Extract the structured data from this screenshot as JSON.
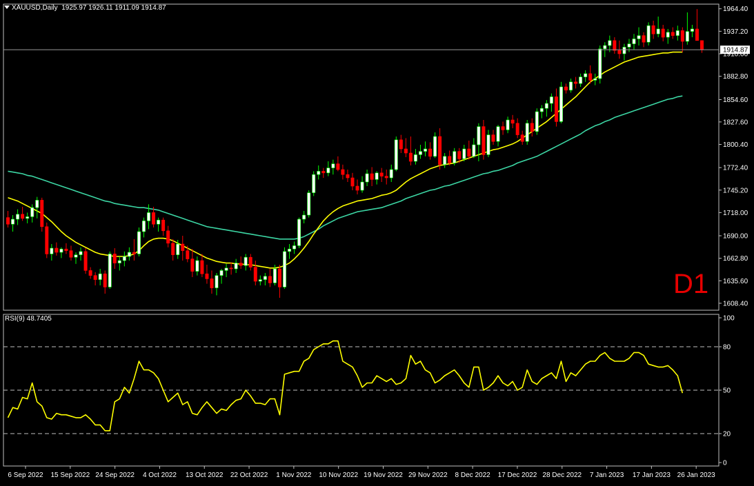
{
  "header": {
    "symbol": "XAUUSD,Daily",
    "ohlc": "1925.97 1926.11 1911.09 1914.87"
  },
  "timeframe_label": "D1",
  "colors": {
    "background": "#000000",
    "grid": "#c0c0c0",
    "bull": "#ffffff",
    "bear": "#ff0000",
    "ma_fast": "#ffff00",
    "ma_slow": "#3cd6a4",
    "rsi": "#ffff00",
    "timeframe": "#e60000"
  },
  "chart_data": [
    {
      "type": "candlestick",
      "title": "XAUUSD,Daily",
      "ylim": [
        1600,
        1970
      ],
      "y_ticks": [
        "1964.40",
        "1937.20",
        "1910.00",
        "1882.80",
        "1854.60",
        "1827.60",
        "1800.40",
        "1772.40",
        "1745.20",
        "1718.00",
        "1690.00",
        "1662.80",
        "1635.60",
        "1608.40"
      ],
      "last_price": "1914.87",
      "x_ticks": [
        "6 Sep 2022",
        "15 Sep 2022",
        "24 Sep 2022",
        "4 Oct 2022",
        "13 Oct 2022",
        "22 Oct 2022",
        "1 Nov 2022",
        "10 Nov 2022",
        "19 Nov 2022",
        "29 Nov 2022",
        "8 Dec 2022",
        "17 Dec 2022",
        "28 Dec 2022",
        "7 Jan 2023",
        "17 Jan 2023",
        "26 Jan 2023"
      ],
      "candles": [
        [
          1712,
          1720,
          1700,
          1704
        ],
        [
          1704,
          1715,
          1695,
          1710
        ],
        [
          1710,
          1722,
          1703,
          1716
        ],
        [
          1716,
          1725,
          1708,
          1711
        ],
        [
          1711,
          1718,
          1705,
          1713
        ],
        [
          1713,
          1728,
          1706,
          1724
        ],
        [
          1724,
          1737,
          1711,
          1733
        ],
        [
          1733,
          1736,
          1695,
          1701
        ],
        [
          1701,
          1706,
          1663,
          1668
        ],
        [
          1668,
          1680,
          1660,
          1675
        ],
        [
          1675,
          1682,
          1666,
          1670
        ],
        [
          1670,
          1676,
          1663,
          1674
        ],
        [
          1674,
          1681,
          1668,
          1672
        ],
        [
          1672,
          1678,
          1660,
          1664
        ],
        [
          1664,
          1670,
          1656,
          1667
        ],
        [
          1667,
          1676,
          1660,
          1671
        ],
        [
          1671,
          1675,
          1644,
          1648
        ],
        [
          1648,
          1652,
          1638,
          1642
        ],
        [
          1642,
          1646,
          1630,
          1637
        ],
        [
          1637,
          1650,
          1630,
          1644
        ],
        [
          1644,
          1648,
          1620,
          1628
        ],
        [
          1628,
          1671,
          1626,
          1668
        ],
        [
          1668,
          1675,
          1650,
          1657
        ],
        [
          1657,
          1665,
          1648,
          1660
        ],
        [
          1660,
          1671,
          1653,
          1665
        ],
        [
          1665,
          1676,
          1660,
          1670
        ],
        [
          1670,
          1686,
          1660,
          1668
        ],
        [
          1668,
          1700,
          1665,
          1695
        ],
        [
          1695,
          1712,
          1688,
          1708
        ],
        [
          1708,
          1728,
          1698,
          1718
        ],
        [
          1718,
          1725,
          1700,
          1704
        ],
        [
          1704,
          1712,
          1695,
          1709
        ],
        [
          1709,
          1712,
          1690,
          1696
        ],
        [
          1696,
          1702,
          1676,
          1681
        ],
        [
          1681,
          1686,
          1660,
          1667
        ],
        [
          1667,
          1685,
          1662,
          1680
        ],
        [
          1680,
          1690,
          1660,
          1672
        ],
        [
          1672,
          1678,
          1658,
          1662
        ],
        [
          1662,
          1674,
          1640,
          1647
        ],
        [
          1647,
          1665,
          1642,
          1660
        ],
        [
          1660,
          1668,
          1640,
          1644
        ],
        [
          1644,
          1655,
          1632,
          1638
        ],
        [
          1638,
          1648,
          1620,
          1627
        ],
        [
          1627,
          1645,
          1618,
          1642
        ],
        [
          1642,
          1650,
          1632,
          1648
        ],
        [
          1648,
          1656,
          1640,
          1651
        ],
        [
          1651,
          1658,
          1643,
          1650
        ],
        [
          1650,
          1662,
          1645,
          1657
        ],
        [
          1657,
          1665,
          1650,
          1654
        ],
        [
          1654,
          1668,
          1648,
          1664
        ],
        [
          1664,
          1668,
          1648,
          1652
        ],
        [
          1652,
          1660,
          1630,
          1635
        ],
        [
          1635,
          1642,
          1630,
          1637
        ],
        [
          1637,
          1645,
          1630,
          1641
        ],
        [
          1641,
          1650,
          1628,
          1633
        ],
        [
          1633,
          1655,
          1630,
          1650
        ],
        [
          1650,
          1655,
          1615,
          1628
        ],
        [
          1628,
          1676,
          1626,
          1671
        ],
        [
          1671,
          1680,
          1662,
          1674
        ],
        [
          1674,
          1683,
          1668,
          1678
        ],
        [
          1678,
          1712,
          1675,
          1710
        ],
        [
          1710,
          1720,
          1705,
          1715
        ],
        [
          1715,
          1745,
          1712,
          1742
        ],
        [
          1742,
          1768,
          1738,
          1764
        ],
        [
          1764,
          1775,
          1758,
          1768
        ],
        [
          1768,
          1772,
          1760,
          1766
        ],
        [
          1766,
          1780,
          1762,
          1772
        ],
        [
          1772,
          1782,
          1764,
          1777
        ],
        [
          1777,
          1786,
          1768,
          1770
        ],
        [
          1770,
          1776,
          1758,
          1764
        ],
        [
          1764,
          1770,
          1755,
          1760
        ],
        [
          1760,
          1766,
          1745,
          1750
        ],
        [
          1750,
          1758,
          1740,
          1745
        ],
        [
          1745,
          1762,
          1742,
          1755
        ],
        [
          1755,
          1770,
          1750,
          1765
        ],
        [
          1765,
          1773,
          1750,
          1758
        ],
        [
          1758,
          1768,
          1752,
          1766
        ],
        [
          1766,
          1772,
          1755,
          1762
        ],
        [
          1762,
          1770,
          1752,
          1760
        ],
        [
          1760,
          1776,
          1755,
          1770
        ],
        [
          1770,
          1810,
          1768,
          1806
        ],
        [
          1806,
          1812,
          1790,
          1795
        ],
        [
          1795,
          1808,
          1785,
          1790
        ],
        [
          1790,
          1810,
          1775,
          1780
        ],
        [
          1780,
          1795,
          1776,
          1788
        ],
        [
          1788,
          1800,
          1783,
          1792
        ],
        [
          1792,
          1804,
          1786,
          1795
        ],
        [
          1795,
          1803,
          1782,
          1786
        ],
        [
          1786,
          1815,
          1784,
          1810
        ],
        [
          1810,
          1820,
          1770,
          1776
        ],
        [
          1776,
          1790,
          1772,
          1786
        ],
        [
          1786,
          1793,
          1775,
          1778
        ],
        [
          1778,
          1796,
          1775,
          1792
        ],
        [
          1792,
          1796,
          1778,
          1783
        ],
        [
          1783,
          1800,
          1780,
          1795
        ],
        [
          1795,
          1805,
          1782,
          1786
        ],
        [
          1786,
          1808,
          1784,
          1800
        ],
        [
          1800,
          1826,
          1780,
          1822
        ],
        [
          1822,
          1830,
          1782,
          1788
        ],
        [
          1788,
          1818,
          1785,
          1812
        ],
        [
          1812,
          1818,
          1800,
          1804
        ],
        [
          1804,
          1824,
          1798,
          1822
        ],
        [
          1822,
          1828,
          1812,
          1818
        ],
        [
          1818,
          1834,
          1814,
          1830
        ],
        [
          1830,
          1836,
          1820,
          1826
        ],
        [
          1826,
          1832,
          1808,
          1812
        ],
        [
          1812,
          1817,
          1800,
          1804
        ],
        [
          1804,
          1830,
          1800,
          1826
        ],
        [
          1826,
          1832,
          1810,
          1816
        ],
        [
          1816,
          1844,
          1812,
          1840
        ],
        [
          1840,
          1848,
          1832,
          1844
        ],
        [
          1844,
          1854,
          1834,
          1850
        ],
        [
          1850,
          1862,
          1840,
          1858
        ],
        [
          1858,
          1868,
          1822,
          1828
        ],
        [
          1828,
          1876,
          1826,
          1870
        ],
        [
          1870,
          1874,
          1862,
          1866
        ],
        [
          1866,
          1880,
          1863,
          1876
        ],
        [
          1876,
          1882,
          1868,
          1874
        ],
        [
          1874,
          1886,
          1870,
          1882
        ],
        [
          1882,
          1890,
          1876,
          1886
        ],
        [
          1886,
          1896,
          1874,
          1878
        ],
        [
          1878,
          1886,
          1872,
          1880
        ],
        [
          1880,
          1920,
          1874,
          1916
        ],
        [
          1916,
          1924,
          1906,
          1920
        ],
        [
          1920,
          1932,
          1912,
          1926
        ],
        [
          1926,
          1930,
          1910,
          1914
        ],
        [
          1914,
          1926,
          1904,
          1910
        ],
        [
          1910,
          1922,
          1902,
          1918
        ],
        [
          1918,
          1928,
          1912,
          1922
        ],
        [
          1922,
          1934,
          1915,
          1928
        ],
        [
          1928,
          1942,
          1920,
          1932
        ],
        [
          1932,
          1936,
          1918,
          1924
        ],
        [
          1924,
          1948,
          1920,
          1944
        ],
        [
          1944,
          1950,
          1928,
          1934
        ],
        [
          1934,
          1955,
          1930,
          1940
        ],
        [
          1940,
          1945,
          1925,
          1930
        ],
        [
          1930,
          1940,
          1922,
          1936
        ],
        [
          1936,
          1942,
          1928,
          1932
        ],
        [
          1932,
          1944,
          1926,
          1938
        ],
        [
          1938,
          1942,
          1912,
          1925
        ],
        [
          1925,
          1960,
          1921,
          1937
        ],
        [
          1937,
          1945,
          1930,
          1940
        ],
        [
          1940,
          1964,
          1933,
          1926
        ],
        [
          1925.97,
          1926.11,
          1911.09,
          1914.87
        ]
      ],
      "ma_fast": [
        1736,
        1734,
        1732,
        1729,
        1726,
        1723,
        1720,
        1717,
        1712,
        1707,
        1701,
        1695,
        1690,
        1686,
        1682,
        1679,
        1676,
        1673,
        1670,
        1668,
        1667,
        1666,
        1665,
        1665,
        1665,
        1666,
        1668,
        1672,
        1678,
        1683,
        1686,
        1687,
        1687,
        1686,
        1684,
        1681,
        1678,
        1675,
        1672,
        1669,
        1666,
        1663,
        1661,
        1659,
        1658,
        1657,
        1657,
        1656,
        1656,
        1655,
        1655,
        1654,
        1653,
        1652,
        1651,
        1651,
        1652,
        1654,
        1657,
        1662,
        1668,
        1675,
        1683,
        1692,
        1700,
        1708,
        1714,
        1719,
        1723,
        1726,
        1728,
        1730,
        1732,
        1733,
        1734,
        1735,
        1737,
        1739,
        1740,
        1742,
        1745,
        1750,
        1755,
        1759,
        1762,
        1765,
        1768,
        1771,
        1773,
        1775,
        1776,
        1777,
        1778,
        1780,
        1782,
        1784,
        1786,
        1788,
        1790,
        1792,
        1794,
        1795,
        1797,
        1799,
        1801,
        1804,
        1808,
        1812,
        1816,
        1820,
        1824,
        1828,
        1833,
        1838,
        1843,
        1848,
        1853,
        1858,
        1864,
        1870,
        1876,
        1880,
        1884,
        1888,
        1891,
        1894,
        1897,
        1900,
        1902,
        1904,
        1906,
        1907,
        1908,
        1909,
        1910,
        1911,
        1911,
        1912,
        1912,
        1912
      ],
      "ma_slow": [
        1768,
        1767,
        1766,
        1765,
        1763,
        1762,
        1760,
        1758,
        1756,
        1754,
        1752,
        1750,
        1748,
        1746,
        1744,
        1742,
        1740,
        1738,
        1736,
        1734,
        1732,
        1731,
        1729,
        1728,
        1727,
        1726,
        1725,
        1724,
        1724,
        1723,
        1722,
        1721,
        1719,
        1717,
        1715,
        1713,
        1711,
        1709,
        1707,
        1705,
        1703,
        1701,
        1700,
        1699,
        1698,
        1697,
        1696,
        1695,
        1694,
        1693,
        1692,
        1691,
        1690,
        1689,
        1688,
        1687,
        1686,
        1686,
        1686,
        1686,
        1687,
        1689,
        1692,
        1695,
        1698,
        1702,
        1705,
        1708,
        1711,
        1713,
        1715,
        1717,
        1719,
        1720,
        1721,
        1722,
        1723,
        1724,
        1726,
        1728,
        1730,
        1732,
        1735,
        1737,
        1739,
        1741,
        1743,
        1745,
        1746,
        1748,
        1750,
        1751,
        1753,
        1755,
        1757,
        1759,
        1761,
        1763,
        1765,
        1766,
        1768,
        1769,
        1771,
        1773,
        1775,
        1778,
        1780,
        1782,
        1784,
        1786,
        1789,
        1792,
        1795,
        1798,
        1801,
        1804,
        1807,
        1810,
        1813,
        1817,
        1820,
        1823,
        1825,
        1828,
        1830,
        1833,
        1835,
        1837,
        1839,
        1841,
        1843,
        1845,
        1847,
        1849,
        1851,
        1853,
        1855,
        1856,
        1858,
        1859
      ]
    },
    {
      "type": "line",
      "title": "RSI(9) 48.7405",
      "ylim": [
        0,
        100
      ],
      "y_ticks": [
        "100",
        "80",
        "50",
        "20",
        "0"
      ],
      "levels": [
        80,
        50,
        20
      ],
      "values": [
        31,
        38,
        37,
        45,
        44,
        55,
        42,
        39,
        31,
        30,
        34,
        33,
        33,
        32,
        31,
        31,
        33,
        30,
        26,
        26,
        22,
        22,
        42,
        44,
        52,
        48,
        58,
        70,
        64,
        64,
        62,
        58,
        50,
        42,
        45,
        48,
        40,
        42,
        34,
        33,
        38,
        42,
        38,
        34,
        37,
        36,
        40,
        43,
        44,
        50,
        46,
        41,
        41,
        40,
        44,
        44,
        33,
        61,
        62,
        63,
        63,
        70,
        72,
        78,
        80,
        82,
        82,
        84,
        84,
        70,
        68,
        66,
        60,
        52,
        55,
        55,
        60,
        58,
        56,
        58,
        54,
        55,
        58,
        74,
        68,
        70,
        64,
        62,
        55,
        57,
        60,
        62,
        64,
        60,
        55,
        52,
        66,
        66,
        50,
        52,
        55,
        60,
        55,
        53,
        56,
        50,
        52,
        64,
        56,
        54,
        58,
        60,
        62,
        58,
        70,
        56,
        62,
        60,
        64,
        68,
        70,
        70,
        74,
        76,
        72,
        70,
        70,
        70,
        72,
        76,
        76,
        74,
        68,
        67,
        66,
        66,
        67,
        64,
        60,
        48
      ]
    }
  ]
}
